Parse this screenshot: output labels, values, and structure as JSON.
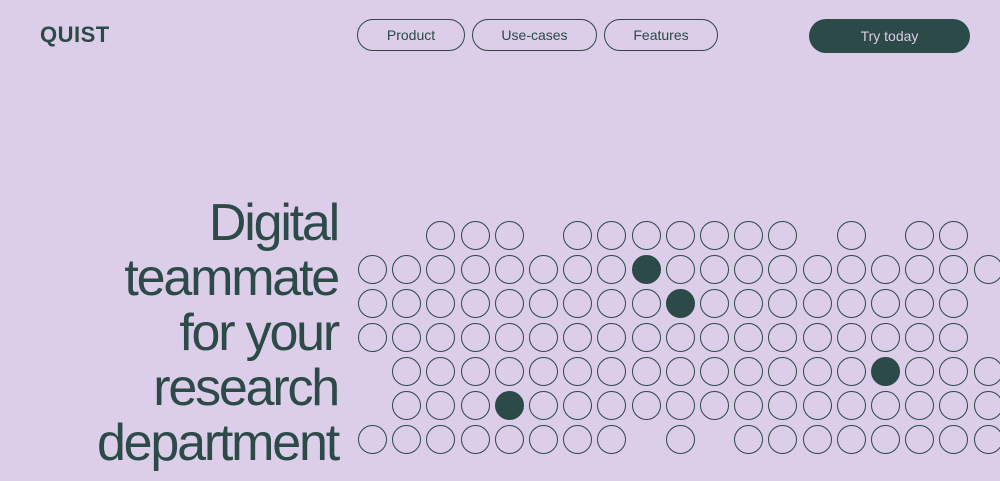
{
  "header": {
    "logo": "QUIST",
    "nav": [
      {
        "label": "Product"
      },
      {
        "label": "Use-cases"
      },
      {
        "label": "Features"
      }
    ],
    "cta_label": "Try today"
  },
  "hero": {
    "headline_lines": [
      "Digital",
      "teammate",
      "for your",
      "research",
      "department"
    ]
  },
  "colors": {
    "background": "#dccde8",
    "accent": "#2b4a48"
  },
  "dot_grid": {
    "rows": [
      "..ooo.ooooooo.o.oo",
      "ooooooooXoooooooooo",
      "oooooooooXoooooooo",
      "oooooooooooooooooo",
      ".ooooooooooooooXooo",
      ".oooXoooooooooooooo",
      "oooooooo.o.oooooooo"
    ]
  }
}
